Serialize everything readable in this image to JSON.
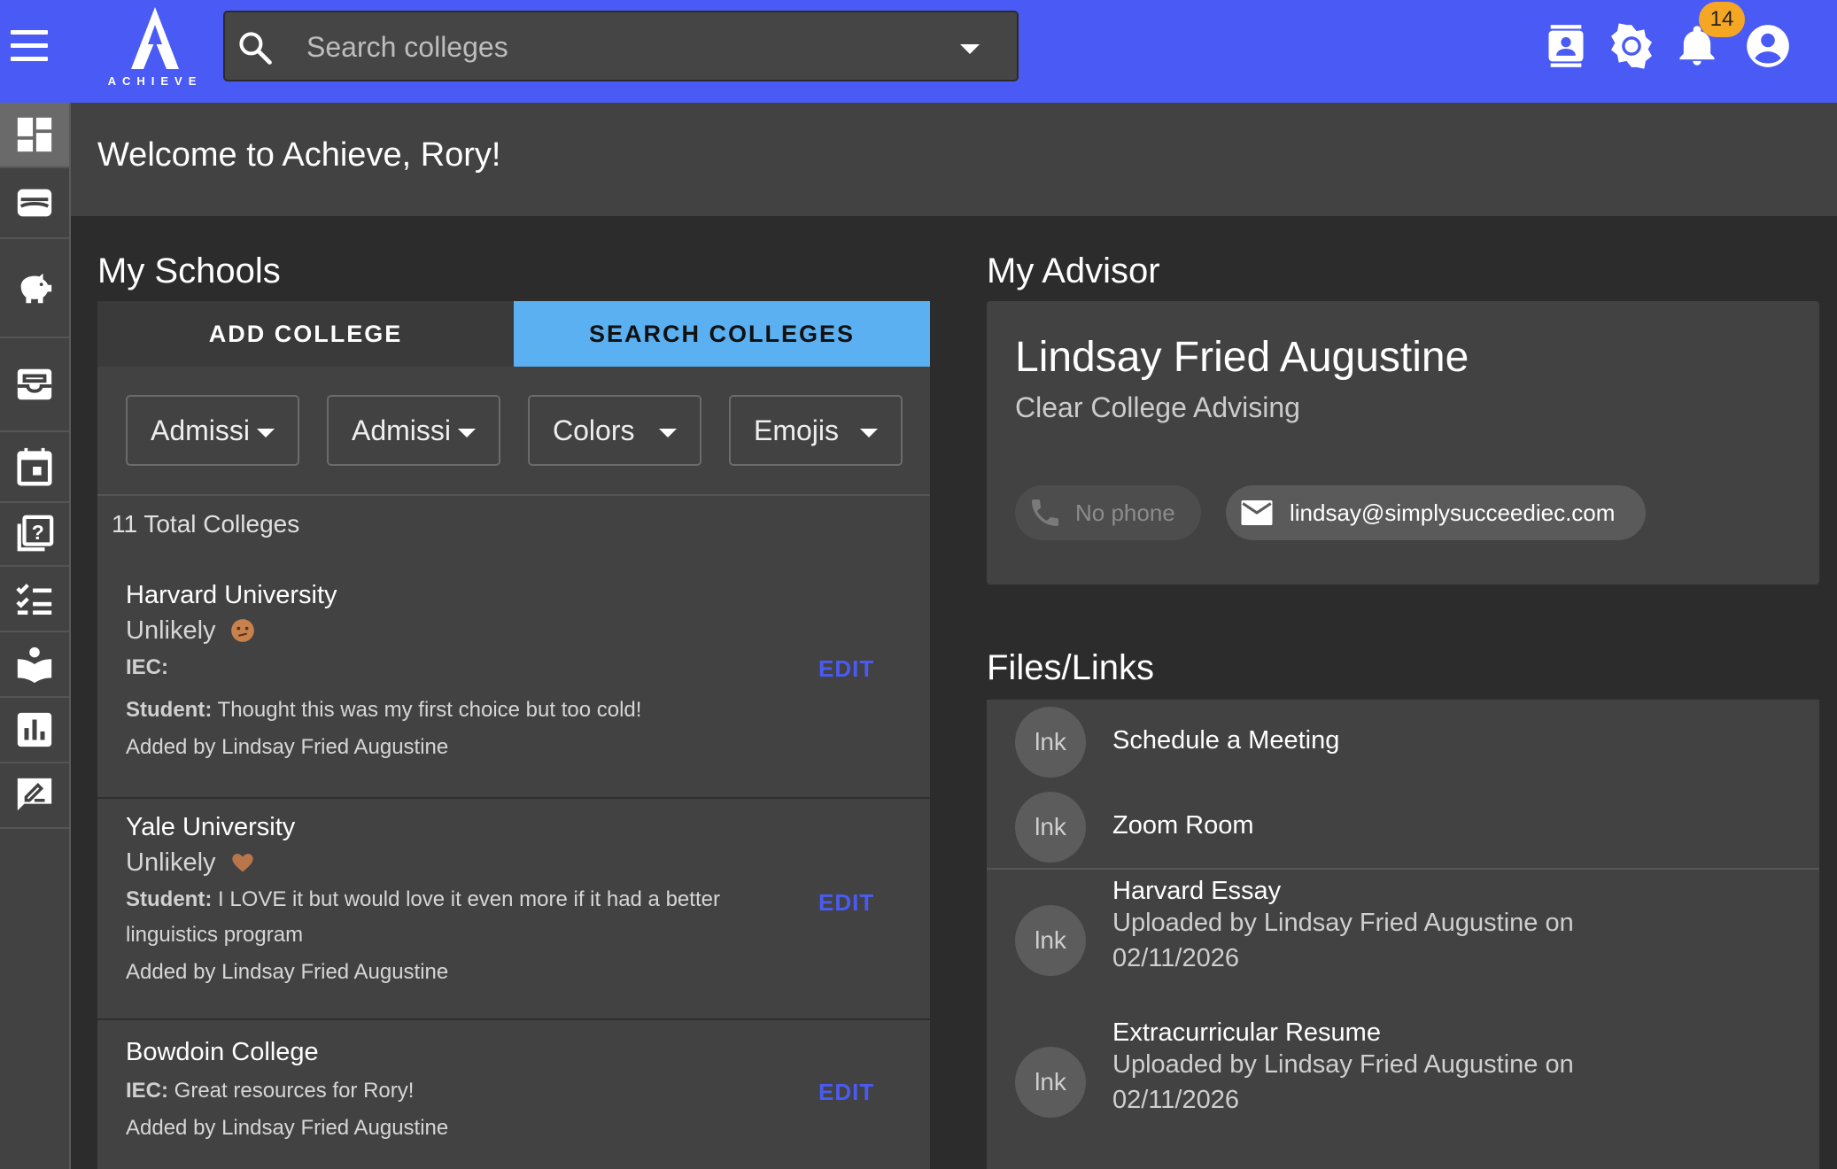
{
  "app": {
    "logo_text": "ACHIEVE",
    "search_placeholder": "Search colleges",
    "notification_count": "14"
  },
  "welcome": "Welcome to Achieve, Rory!",
  "my_schools": {
    "title": "My Schools",
    "tabs": {
      "add": "ADD COLLEGE",
      "search": "SEARCH COLLEGES"
    },
    "filters": [
      "Admissi",
      "Admissi",
      "Colors",
      "Emojis"
    ],
    "total": "11 Total Colleges",
    "colleges": [
      {
        "name": "Harvard University",
        "status": "Unlikely",
        "emoji": "confused-face",
        "iec_label": "IEC:",
        "student_label": "Student:",
        "student_note": " Thought this was my first choice but too cold!",
        "added_by": "Added by Lindsay Fried Augustine",
        "edit": "EDIT"
      },
      {
        "name": "Yale University",
        "status": "Unlikely",
        "emoji": "heart",
        "student_label": "Student:",
        "student_note": " I LOVE it but would love it even more if it had a better linguistics program",
        "added_by": "Added by Lindsay Fried Augustine",
        "edit": "EDIT"
      },
      {
        "name": "Bowdoin College",
        "iec_label": "IEC:",
        "iec_note": " Great resources for Rory!",
        "added_by": "Added by Lindsay Fried Augustine",
        "edit": "EDIT"
      }
    ]
  },
  "advisor": {
    "title": "My Advisor",
    "name": "Lindsay Fried Augustine",
    "org": "Clear College Advising",
    "phone": "No phone",
    "email": "lindsay@simplysucceediec.com"
  },
  "files": {
    "title": "Files/Links",
    "items": [
      {
        "avatar": "lnk",
        "title": "Schedule a Meeting"
      },
      {
        "avatar": "lnk",
        "title": "Zoom Room"
      },
      {
        "avatar": "lnk",
        "title": "Harvard Essay",
        "sub1": "Uploaded by Lindsay Fried Augustine on",
        "sub2": "02/11/2026"
      },
      {
        "avatar": "lnk",
        "title": "Extracurricular Resume",
        "sub1": "Uploaded by Lindsay Fried Augustine on",
        "sub2": "02/11/2026"
      }
    ]
  },
  "colors": {
    "app_bar": "#4a5bf5",
    "search_tab": "#5ab0f0",
    "badge": "#f5a623",
    "edit_link": "#4a5bf5"
  }
}
